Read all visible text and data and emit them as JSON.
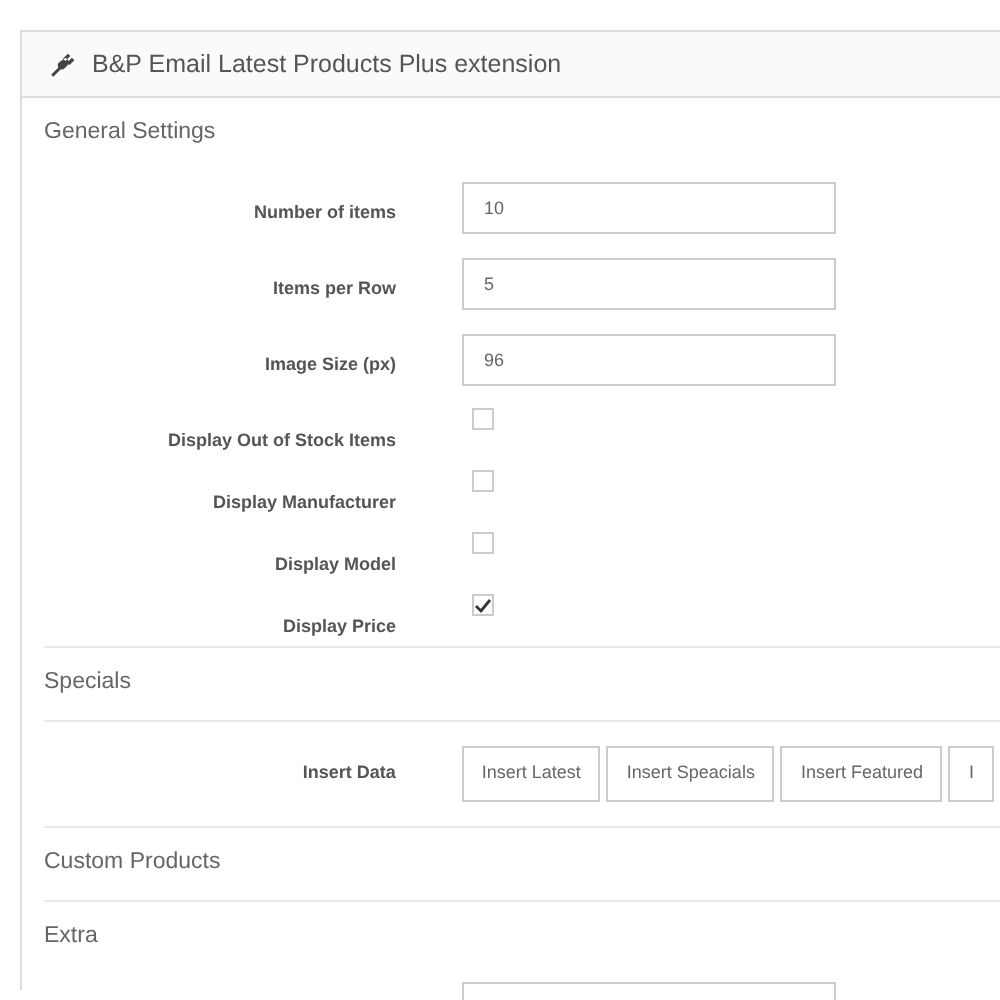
{
  "panel": {
    "title": "B&P Email Latest Products Plus extension"
  },
  "sections": [
    {
      "heading": "General Settings",
      "fields": [
        {
          "kind": "text",
          "label": "Number of items",
          "value": "10"
        },
        {
          "kind": "text",
          "label": "Items per Row",
          "value": "5"
        },
        {
          "kind": "text",
          "label": "Image Size (px)",
          "value": "96"
        },
        {
          "kind": "checkbox",
          "label": "Display Out of Stock Items",
          "checked": false
        },
        {
          "kind": "checkbox",
          "label": "Display Manufacturer",
          "checked": false
        },
        {
          "kind": "checkbox",
          "label": "Display Model",
          "checked": false
        },
        {
          "kind": "checkbox",
          "label": "Display Price",
          "checked": true
        }
      ]
    },
    {
      "heading": "Specials",
      "fields": [
        {
          "kind": "buttons",
          "label": "Insert Data",
          "buttons": [
            "Insert Latest",
            "Insert Speacials",
            "Insert Featured",
            "I"
          ]
        }
      ]
    },
    {
      "heading": "Custom Products"
    },
    {
      "heading": "Extra",
      "fields": [
        {
          "kind": "text"
        }
      ]
    }
  ]
}
